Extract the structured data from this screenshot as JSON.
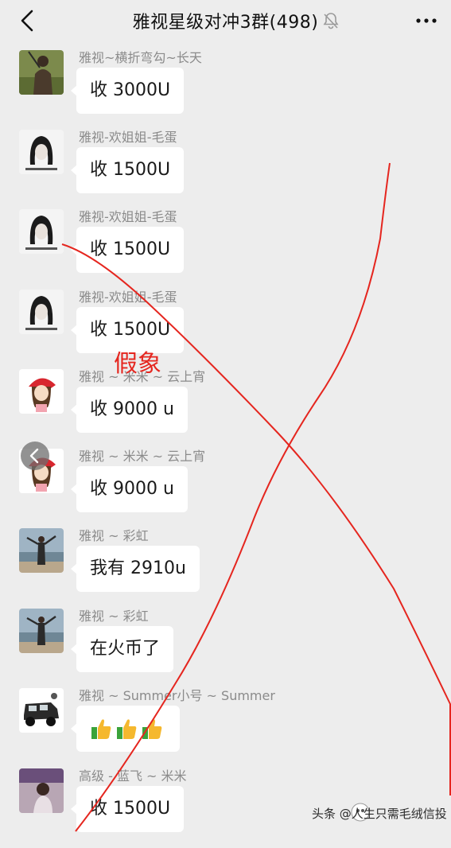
{
  "header": {
    "title": "雅视星级对冲3群(498)"
  },
  "messages": [
    {
      "sender": "雅视~横折弯勾~长天",
      "text": "收 3000U",
      "avatar": "avatar-person-outdoor"
    },
    {
      "sender": "雅视-欢姐姐-毛蛋",
      "text": "收 1500U",
      "avatar": "avatar-girl-sketch"
    },
    {
      "sender": "雅视-欢姐姐-毛蛋",
      "text": "收 1500U",
      "avatar": "avatar-girl-sketch"
    },
    {
      "sender": "雅视-欢姐姐-毛蛋",
      "text": "收 1500U",
      "avatar": "avatar-girl-sketch"
    },
    {
      "sender": "雅视 ~ 米米 ~ 云上宵",
      "text": "收 9000 u",
      "avatar": "avatar-cartoon-girl-red-hat"
    },
    {
      "sender": "雅视 ~ 米米 ~ 云上宵",
      "text": "收 9000 u",
      "avatar": "avatar-cartoon-girl-red-hat"
    },
    {
      "sender": "雅视 ~ 彩虹",
      "text": "我有 2910u",
      "avatar": "avatar-beach-person"
    },
    {
      "sender": "雅视 ~ 彩虹",
      "text": "在火币了",
      "avatar": "avatar-beach-person"
    },
    {
      "sender": "雅视 ~ Summer小号 ~ Summer",
      "text": "",
      "emoji": [
        "thumbs-up-icon",
        "thumbs-up-icon",
        "thumbs-up-icon"
      ],
      "avatar": "avatar-jeep"
    },
    {
      "sender": "高级 - 蓝飞 ~ 米米",
      "text": "收 1500U",
      "avatar": "avatar-girl-photo"
    }
  ],
  "annotation": {
    "text": "假象",
    "color": "#e5261f"
  },
  "watermark": {
    "text": "头条 @人生只需毛绒信投"
  },
  "colors": {
    "background": "#ededed",
    "bubble": "#ffffff",
    "sender": "#8b8b8b",
    "annotation_line": "#e5261f"
  }
}
